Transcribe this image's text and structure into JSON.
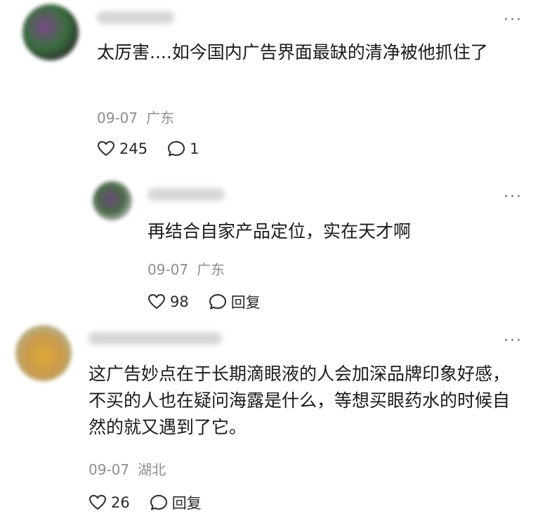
{
  "comments": [
    {
      "text": "太厉害....如今国内广告界面最缺的清净被他抓住了",
      "date": "09-07",
      "location": "广东",
      "likes": "245",
      "replies": "1"
    },
    {
      "text": "再结合自家产品定位，实在天才啊",
      "date": "09-07",
      "location": "广东",
      "likes": "98",
      "reply_label": "回复"
    },
    {
      "text": "这广告妙点在于长期滴眼液的人会加深品牌印象好感，不买的人也在疑问海露是什么，等想买眼药水的时候自然的就又遇到了它。",
      "date": "09-07",
      "location": "湖北",
      "likes": "26",
      "reply_label": "回复"
    }
  ],
  "more_glyph": "···",
  "icons": [
    "heart-icon",
    "comment-bubble-icon"
  ]
}
